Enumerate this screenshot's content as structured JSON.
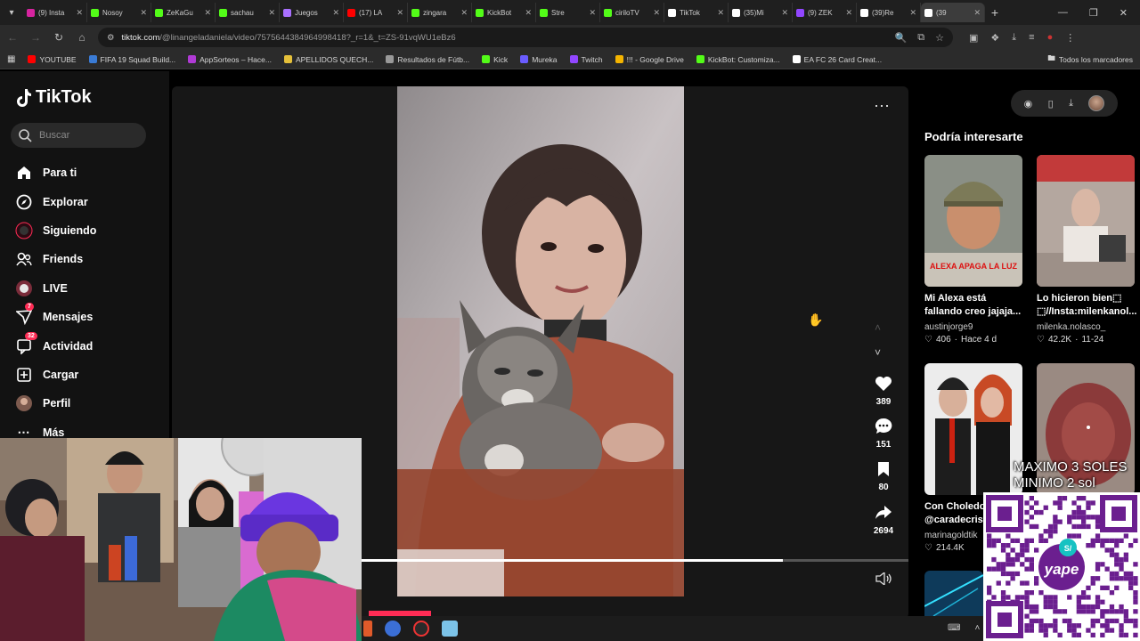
{
  "browser": {
    "tabs": [
      {
        "title": "(9) Insta",
        "color": "#d6249f"
      },
      {
        "title": "Nosoy",
        "color": "#53fc18"
      },
      {
        "title": "ZeKaGu",
        "color": "#53fc18"
      },
      {
        "title": "sachau",
        "color": "#53fc18"
      },
      {
        "title": "Juegos",
        "color": "#a970ff"
      },
      {
        "title": "(17) LA",
        "color": "#ff0000"
      },
      {
        "title": "zingara",
        "color": "#53fc18"
      },
      {
        "title": "KickBot",
        "color": "#53fc18"
      },
      {
        "title": "Stre",
        "color": "#53fc18"
      },
      {
        "title": "ciriloTV",
        "color": "#53fc18"
      },
      {
        "title": "TikTok",
        "color": "#ffffff"
      },
      {
        "title": "(35)Mi",
        "color": "#ffffff"
      },
      {
        "title": "(9) ZEK",
        "color": "#9146ff"
      },
      {
        "title": "(39)Re",
        "color": "#ffffff"
      },
      {
        "title": "(39",
        "color": "#ffffff"
      }
    ],
    "url_host": "tiktok.com",
    "url_path": "/@linangeladaniela/video/7575644384964998418?_r=1&_t=ZS-91vqWU1eBz6",
    "bookmarks": [
      {
        "label": "YOUTUBE",
        "color": "#ff0000"
      },
      {
        "label": "FIFA 19 Squad Build...",
        "color": "#3a7bd5"
      },
      {
        "label": "AppSorteos – Hace...",
        "color": "#b03ad5"
      },
      {
        "label": "APELLIDOS QUECH...",
        "color": "#e5c03a"
      },
      {
        "label": "Resultados de Fútb...",
        "color": "#999999"
      },
      {
        "label": "Kick",
        "color": "#53fc18"
      },
      {
        "label": "Mureka",
        "color": "#6a5cff"
      },
      {
        "label": "Twitch",
        "color": "#9146ff"
      },
      {
        "label": "!!! - Google Drive",
        "color": "#f4b400"
      },
      {
        "label": "KickBot: Customiza...",
        "color": "#53fc18"
      },
      {
        "label": "EA FC 26 Card Creat...",
        "color": "#ffffff"
      }
    ],
    "all_bookmarks": "Todos los marcadores"
  },
  "tiktok": {
    "logo": "TikTok",
    "search_placeholder": "Buscar",
    "nav": [
      {
        "label": "Para ti",
        "icon": "home-icon"
      },
      {
        "label": "Explorar",
        "icon": "compass-icon"
      },
      {
        "label": "Siguiendo",
        "icon": "following-icon"
      },
      {
        "label": "Friends",
        "icon": "friends-icon"
      },
      {
        "label": "LIVE",
        "icon": "live-icon"
      },
      {
        "label": "Mensajes",
        "icon": "messages-icon",
        "badge": "7"
      },
      {
        "label": "Actividad",
        "icon": "activity-icon",
        "badge": "32"
      },
      {
        "label": "Cargar",
        "icon": "upload-icon"
      },
      {
        "label": "Perfil",
        "icon": "profile-icon"
      },
      {
        "label": "Más",
        "icon": "more-icon"
      }
    ],
    "video": {
      "likes": "389",
      "comments": "151",
      "saves": "80",
      "shares": "2694",
      "progress": 0.77
    },
    "suggested": {
      "title": "Podría interesarte",
      "cards": [
        {
          "desc": "Mi Alexa está fallando creo jajaja...",
          "author": "austinjorge9",
          "likes": "406",
          "date": "Hace 4 d",
          "thumb_caption": "ALEXA APAGA LA LUZ"
        },
        {
          "desc": "Lo hicieron bien⬚ ⬚//Insta:milenkanol...",
          "author": "milenka.nolasco_",
          "likes": "42.2K",
          "date": "11-24"
        },
        {
          "desc": "Con Choledo @caradecris",
          "author": "marinagoldtik",
          "likes": "214.4K",
          "date": ""
        },
        {
          "desc": "",
          "author": "",
          "likes": "",
          "date": ""
        }
      ]
    }
  },
  "overlay": {
    "qr_line1": "MAXIMO 3 SOLES",
    "qr_line2": "MINIMO 2 sol",
    "qr_brand": "yape",
    "qr_symbol": "S/"
  }
}
